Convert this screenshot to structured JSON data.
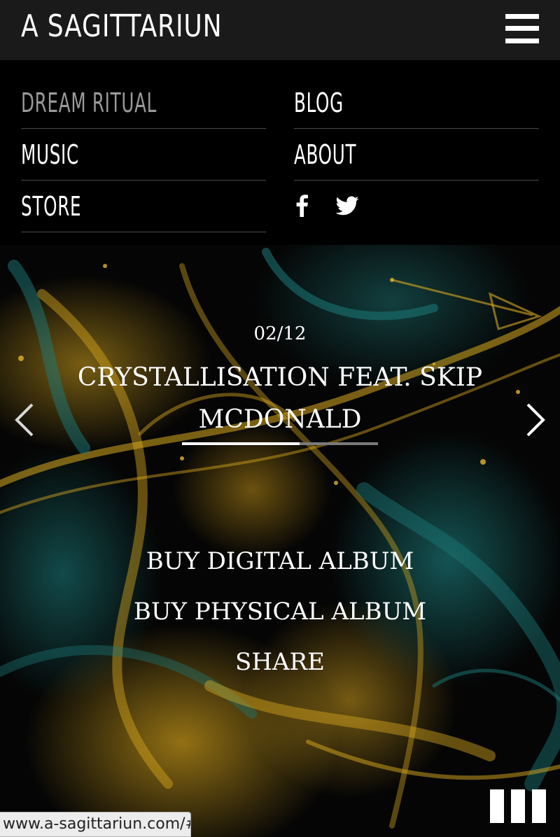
{
  "header": {
    "logo": "A SAGITTARIUN"
  },
  "menu": {
    "left": [
      {
        "label": "DREAM RITUAL",
        "active": true
      },
      {
        "label": "MUSIC",
        "active": false
      },
      {
        "label": "STORE",
        "active": false
      }
    ],
    "right": [
      {
        "label": "BLOG"
      },
      {
        "label": "ABOUT"
      }
    ],
    "social": [
      "facebook-icon",
      "twitter-icon"
    ]
  },
  "slider": {
    "counter": "02/12",
    "title": "CRYSTALLISATION FEAT. SKIP MCDONALD",
    "progress_percent": 60
  },
  "actions": {
    "buy_digital": "BUY DIGITAL ALBUM",
    "buy_physical": "BUY PHYSICAL ALBUM",
    "share": "SHARE"
  },
  "status_bar": {
    "url": "www.a-sagittariun.com/#"
  },
  "colors": {
    "header_bg": "#1a1a1a",
    "menu_bg": "#000000",
    "active_menu": "#9a9a9a",
    "gold": "#d6a61e",
    "teal": "#1a6e6e"
  }
}
